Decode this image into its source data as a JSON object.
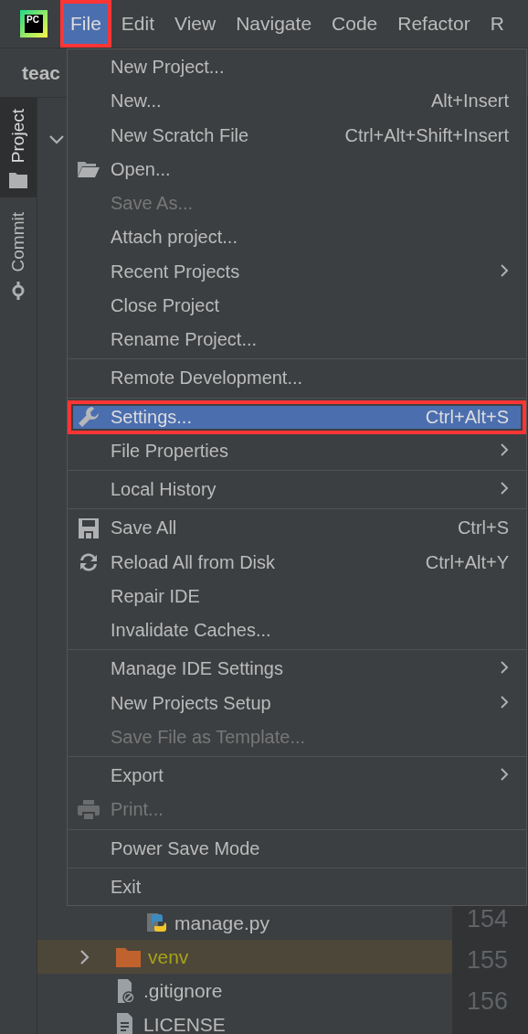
{
  "app_logo": {
    "text": "PC"
  },
  "menubar": {
    "items": [
      {
        "label": "File",
        "selected": true,
        "annotated": true
      },
      {
        "label": "Edit",
        "selected": false,
        "annotated": false
      },
      {
        "label": "View",
        "selected": false,
        "annotated": false
      },
      {
        "label": "Navigate",
        "selected": false,
        "annotated": false
      },
      {
        "label": "Code",
        "selected": false,
        "annotated": false
      },
      {
        "label": "Refactor",
        "selected": false,
        "annotated": false
      },
      {
        "label": "R",
        "selected": false,
        "annotated": false
      }
    ]
  },
  "toolbar": {
    "project_name": "teac"
  },
  "tool_tabs": [
    {
      "label": "Project",
      "kind": "project",
      "selected": true
    },
    {
      "label": "Commit",
      "kind": "commit",
      "selected": false
    }
  ],
  "project_tree": {
    "root": {
      "expanded": true
    },
    "rows": [
      {
        "label": "manage.py",
        "kind": "python",
        "selected": false,
        "excluded": false
      },
      {
        "label": "venv",
        "kind": "folder",
        "expanded": false,
        "selected": true,
        "excluded": true
      },
      {
        "label": ".gitignore",
        "kind": "ignore",
        "selected": false,
        "excluded": false
      },
      {
        "label": "LICENSE",
        "kind": "text",
        "selected": false,
        "excluded": false
      }
    ]
  },
  "gutter": {
    "line_numbers": [
      "154",
      "155",
      "156"
    ]
  },
  "file_menu": {
    "sections": [
      {
        "items": [
          {
            "label": "New Project...",
            "kind": "plain",
            "disabled": false,
            "submenu": false,
            "selected": false,
            "annotated": false
          },
          {
            "label": "New...",
            "shortcut": "Alt+Insert",
            "kind": "plain",
            "disabled": false,
            "submenu": false,
            "selected": false,
            "annotated": false
          },
          {
            "label": "New Scratch File",
            "shortcut": "Ctrl+Alt+Shift+Insert",
            "kind": "plain",
            "disabled": false,
            "submenu": false,
            "selected": false,
            "annotated": false
          },
          {
            "label": "Open...",
            "kind": "folder",
            "disabled": false,
            "submenu": false,
            "selected": false,
            "annotated": false
          },
          {
            "label": "Save As...",
            "kind": "plain",
            "disabled": true,
            "submenu": false,
            "selected": false,
            "annotated": false
          },
          {
            "label": "Attach project...",
            "kind": "plain",
            "disabled": false,
            "submenu": false,
            "selected": false,
            "annotated": false
          },
          {
            "label": "Recent Projects",
            "kind": "plain",
            "disabled": false,
            "submenu": true,
            "selected": false,
            "annotated": false
          },
          {
            "label": "Close Project",
            "kind": "plain",
            "disabled": false,
            "submenu": false,
            "selected": false,
            "annotated": false
          },
          {
            "label": "Rename Project...",
            "kind": "plain",
            "disabled": false,
            "submenu": false,
            "selected": false,
            "annotated": false
          }
        ]
      },
      {
        "items": [
          {
            "label": "Remote Development...",
            "kind": "plain",
            "disabled": false,
            "submenu": false,
            "selected": false,
            "annotated": false
          }
        ]
      },
      {
        "items": [
          {
            "label": "Settings...",
            "shortcut": "Ctrl+Alt+S",
            "kind": "wrench",
            "disabled": false,
            "submenu": false,
            "selected": true,
            "annotated": true
          },
          {
            "label": "File Properties",
            "kind": "plain",
            "disabled": false,
            "submenu": true,
            "selected": false,
            "annotated": false
          }
        ]
      },
      {
        "items": [
          {
            "label": "Local History",
            "kind": "plain",
            "disabled": false,
            "submenu": true,
            "selected": false,
            "annotated": false
          }
        ]
      },
      {
        "items": [
          {
            "label": "Save All",
            "shortcut": "Ctrl+S",
            "kind": "save",
            "disabled": false,
            "submenu": false,
            "selected": false,
            "annotated": false
          },
          {
            "label": "Reload All from Disk",
            "shortcut": "Ctrl+Alt+Y",
            "kind": "reload",
            "disabled": false,
            "submenu": false,
            "selected": false,
            "annotated": false
          },
          {
            "label": "Repair IDE",
            "kind": "plain",
            "disabled": false,
            "submenu": false,
            "selected": false,
            "annotated": false
          },
          {
            "label": "Invalidate Caches...",
            "kind": "plain",
            "disabled": false,
            "submenu": false,
            "selected": false,
            "annotated": false
          }
        ]
      },
      {
        "items": [
          {
            "label": "Manage IDE Settings",
            "kind": "plain",
            "disabled": false,
            "submenu": true,
            "selected": false,
            "annotated": false
          },
          {
            "label": "New Projects Setup",
            "kind": "plain",
            "disabled": false,
            "submenu": true,
            "selected": false,
            "annotated": false
          },
          {
            "label": "Save File as Template...",
            "kind": "plain",
            "disabled": true,
            "submenu": false,
            "selected": false,
            "annotated": false
          }
        ]
      },
      {
        "items": [
          {
            "label": "Export",
            "kind": "plain",
            "disabled": false,
            "submenu": true,
            "selected": false,
            "annotated": false
          },
          {
            "label": "Print...",
            "kind": "printer",
            "disabled": true,
            "submenu": false,
            "selected": false,
            "annotated": false
          }
        ]
      },
      {
        "items": [
          {
            "label": "Power Save Mode",
            "kind": "plain",
            "disabled": false,
            "submenu": false,
            "selected": false,
            "annotated": false
          }
        ]
      },
      {
        "items": [
          {
            "label": "Exit",
            "kind": "plain",
            "disabled": false,
            "submenu": false,
            "selected": false,
            "annotated": false
          }
        ]
      }
    ]
  }
}
